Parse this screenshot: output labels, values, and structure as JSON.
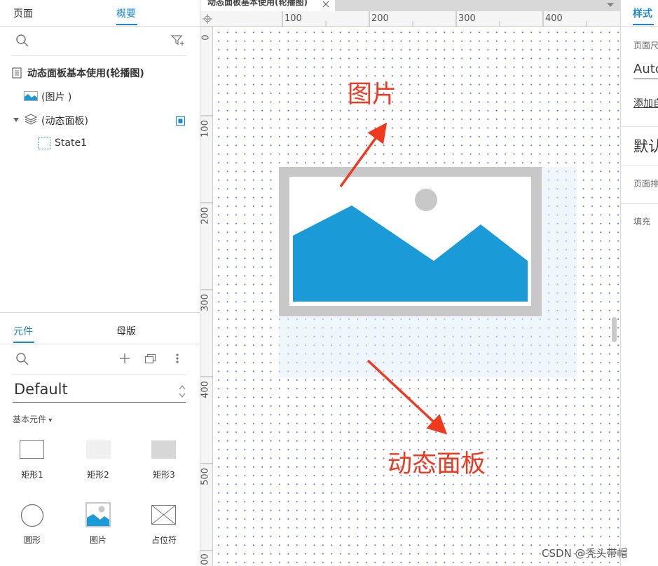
{
  "left_top_panel": {
    "tabs": [
      {
        "label": "页面"
      },
      {
        "label": "概要"
      }
    ],
    "tree": {
      "root": "动态面板基本使用(轮播图)",
      "image_item": "(图片 )",
      "panel_item": "(动态面板)",
      "state_item": "State1"
    }
  },
  "left_bottom_panel": {
    "tabs": [
      {
        "label": "元件"
      },
      {
        "label": "母版"
      }
    ],
    "library": "Default",
    "category": "基本元件",
    "widgets": [
      "矩形1",
      "矩形2",
      "矩形3",
      "圆形",
      "图片",
      "占位符"
    ]
  },
  "canvas": {
    "tab_title": "动态面板基本使用(轮播图)",
    "ruler_top": [
      "100",
      "200",
      "300",
      "400"
    ],
    "ruler_left": [
      "0",
      "100",
      "200",
      "300",
      "400",
      "500",
      "00"
    ],
    "annotation_image": "图片",
    "annotation_panel": "动态面板",
    "colors": {
      "image_blue": "#1a9bd7",
      "annotation_red": "#f03a20",
      "frame_gray": "#c8c8c8"
    }
  },
  "right_panel": {
    "tab": "样式",
    "page_size_label": "页面尺",
    "auto_value": "Autc",
    "add_link": "添加自",
    "default_label": "默认",
    "page_arrange": "页面排",
    "fill_label": "填充"
  },
  "watermark": "CSDN @秃头带帽"
}
